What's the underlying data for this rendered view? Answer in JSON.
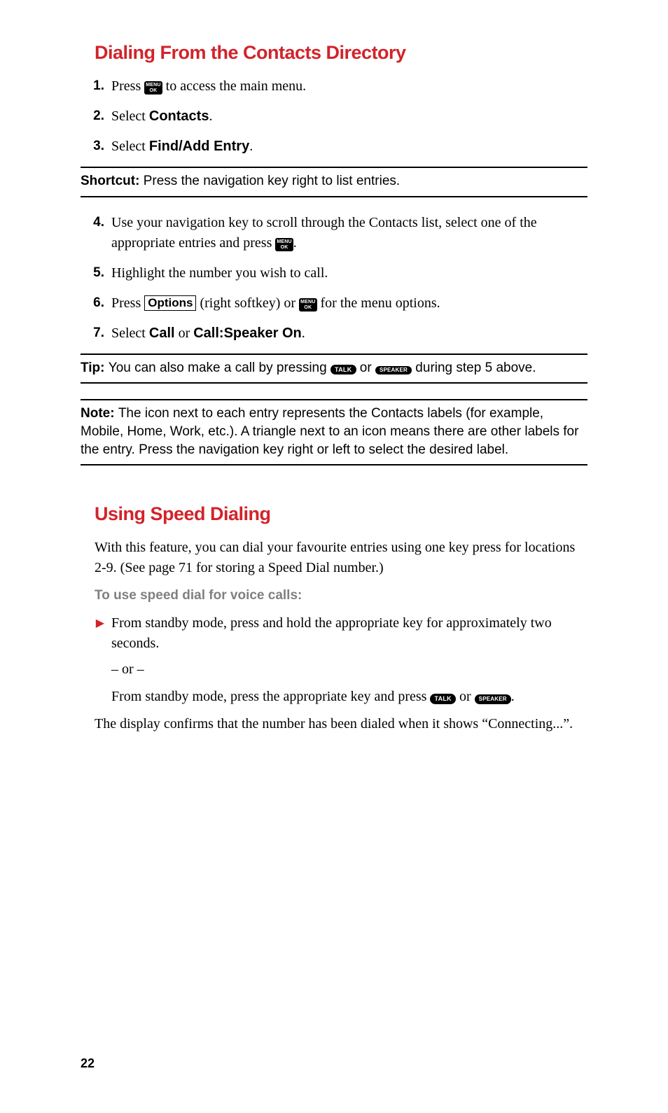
{
  "section1": {
    "heading": "Dialing From the Contacts Directory",
    "steps": {
      "n1": "1.",
      "s1a": "Press ",
      "s1b": " to access the main menu.",
      "n2": "2.",
      "s2a": "Select ",
      "s2b": "Contacts",
      "s2c": ".",
      "n3": "3.",
      "s3a": "Select ",
      "s3b": "Find/Add Entry",
      "s3c": "."
    },
    "shortcut": {
      "label": "Shortcut: ",
      "text": "Press the navigation key right to list entries."
    },
    "steps2": {
      "n4": "4.",
      "s4a": "Use your navigation key to scroll through the Contacts list, select one of the appropriate entries and press ",
      "s4b": ".",
      "n5": "5.",
      "s5": "Highlight the number you wish to call.",
      "n6": "6.",
      "s6a": "Press ",
      "s6b": "Options",
      "s6c": " (right softkey) or ",
      "s6d": " for the menu options.",
      "n7": "7.",
      "s7a": "Select ",
      "s7b": "Call",
      "s7c": " or ",
      "s7d": "Call:Speaker On",
      "s7e": "."
    },
    "tip": {
      "label": "Tip: ",
      "a": "You can also make a call by pressing ",
      "b": " or ",
      "c": " during step 5 above."
    },
    "note": {
      "label": "Note: ",
      "text": "The icon next to each entry represents the Contacts labels (for example, Mobile, Home, Work, etc.). A triangle next to an icon means there are other labels for the entry. Press the navigation key right or left to select the desired label."
    }
  },
  "section2": {
    "heading": "Using Speed Dialing",
    "intro": "With this feature, you can dial your favourite entries using one key press for locations 2-9. (See page 71 for storing a Speed Dial number.)",
    "sub": "To use speed dial for voice calls:",
    "b1": "From standby mode, press and hold the appropriate key for approximately two seconds.",
    "or": "– or –",
    "b2a": "From standby mode, press the appropriate key and press ",
    "b2b": " or ",
    "b2c": ".",
    "closing": "The display confirms that the number has been dialed when it shows “Connecting...”."
  },
  "keys": {
    "menu": "MENU",
    "ok": "OK",
    "talk": "TALK",
    "speaker": "SPEAKER"
  },
  "pageNumber": "22"
}
